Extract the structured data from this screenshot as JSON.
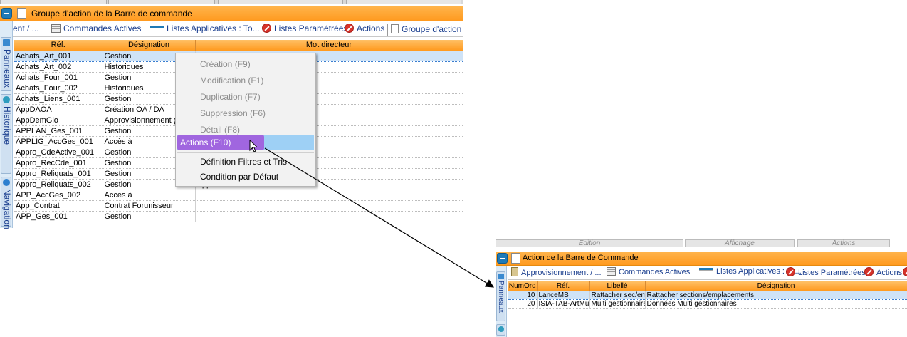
{
  "window1": {
    "title": "Groupe d'action de la Barre de commande",
    "tabs": [
      {
        "label": "ent / ...",
        "icon": "none"
      },
      {
        "label": "Commandes Actives",
        "icon": "grid-icon"
      },
      {
        "label": "Listes Applicatives : To...",
        "icon": "bar-icon"
      },
      {
        "label": "Listes Paramétrées",
        "icon": "red-action-icon"
      },
      {
        "label": "Actions",
        "icon": "red-action-icon"
      },
      {
        "label": "Groupe d'action",
        "icon": "doc-icon"
      }
    ],
    "side_tabs": [
      {
        "label": "Panneaux"
      },
      {
        "label": "Historique"
      },
      {
        "label": "Navigation"
      }
    ],
    "columns": [
      "Réf.",
      "Désignation",
      "Mot directeur"
    ],
    "rows": [
      [
        "Achats_Art_001",
        "Gestion",
        ""
      ],
      [
        "Achats_Art_002",
        "Historiques",
        ""
      ],
      [
        "Achats_Four_001",
        "Gestion",
        ""
      ],
      [
        "Achats_Four_002",
        "Historiques",
        ""
      ],
      [
        "Achats_Liens_001",
        "Gestion",
        ""
      ],
      [
        "AppDAOA",
        "Création OA / DA",
        ""
      ],
      [
        "AppDemGlo",
        "Approvisionnement glo",
        ""
      ],
      [
        "APPLAN_Ges_001",
        "Gestion",
        ""
      ],
      [
        "APPLIG_AccGes_001",
        "Accès à",
        ""
      ],
      [
        "Appro_CdeActive_001",
        "Gestion",
        ""
      ],
      [
        "Appro_RecCde_001",
        "Gestion",
        ""
      ],
      [
        "Appro_Reliquats_001",
        "Gestion",
        ""
      ],
      [
        "Appro_Reliquats_002",
        "Gestion",
        "Appro"
      ],
      [
        "APP_AccGes_002",
        "Accès à",
        ""
      ],
      [
        "App_Contrat",
        "Contrat Forunisseur",
        ""
      ],
      [
        "APP_Ges_001",
        "Gestion",
        ""
      ]
    ],
    "context_menu": {
      "items": [
        {
          "label": "Création (F9)",
          "enabled": false
        },
        {
          "label": "Modification (F1)",
          "enabled": false
        },
        {
          "label": "Duplication (F7)",
          "enabled": false
        },
        {
          "label": "Suppression (F6)",
          "enabled": false
        },
        {
          "label": "Détail (F8)",
          "enabled": false
        },
        {
          "label": "Actions (F10)",
          "enabled": true
        },
        {
          "label": "Définition Filtres et Tris",
          "enabled": true
        },
        {
          "label": "Condition par Défaut",
          "enabled": true
        }
      ]
    }
  },
  "window2": {
    "section_headers": [
      "Edition",
      "Affichage",
      "Actions"
    ],
    "title": "Action de la Barre de Commande",
    "tabs": [
      {
        "label": "Approvisionnement / ...",
        "icon": "clipboard-icon"
      },
      {
        "label": "Commandes Actives",
        "icon": "grid-icon"
      },
      {
        "label": "Listes Applicatives : To...",
        "icon": "bar-icon"
      },
      {
        "label": "Listes Paramétrées",
        "icon": "red-action-icon"
      },
      {
        "label": "Actions",
        "icon": "red-action-icon"
      }
    ],
    "side_tabs": [
      {
        "label": "Panneaux"
      }
    ],
    "columns": [
      "NumOrd",
      "Réf.",
      "Libellé",
      "Désignation"
    ],
    "rows": [
      [
        "10",
        "LanceMB",
        "Rattacher sec/emp",
        "Rattacher sections/emplacements"
      ],
      [
        "20",
        "ISIA-TAB-ArtMulSit",
        "Multi gestionnaires",
        "Données Multi gestionnaires"
      ]
    ]
  },
  "colors": {
    "title_orange": "#ffa42e",
    "header_orange": "#ff9a1f",
    "selection_blue": "#cfe3f7",
    "menu_highlight": "#9ed0f5",
    "menu_badge_purple": "#a066df",
    "link_blue": "#1b3f8f"
  }
}
